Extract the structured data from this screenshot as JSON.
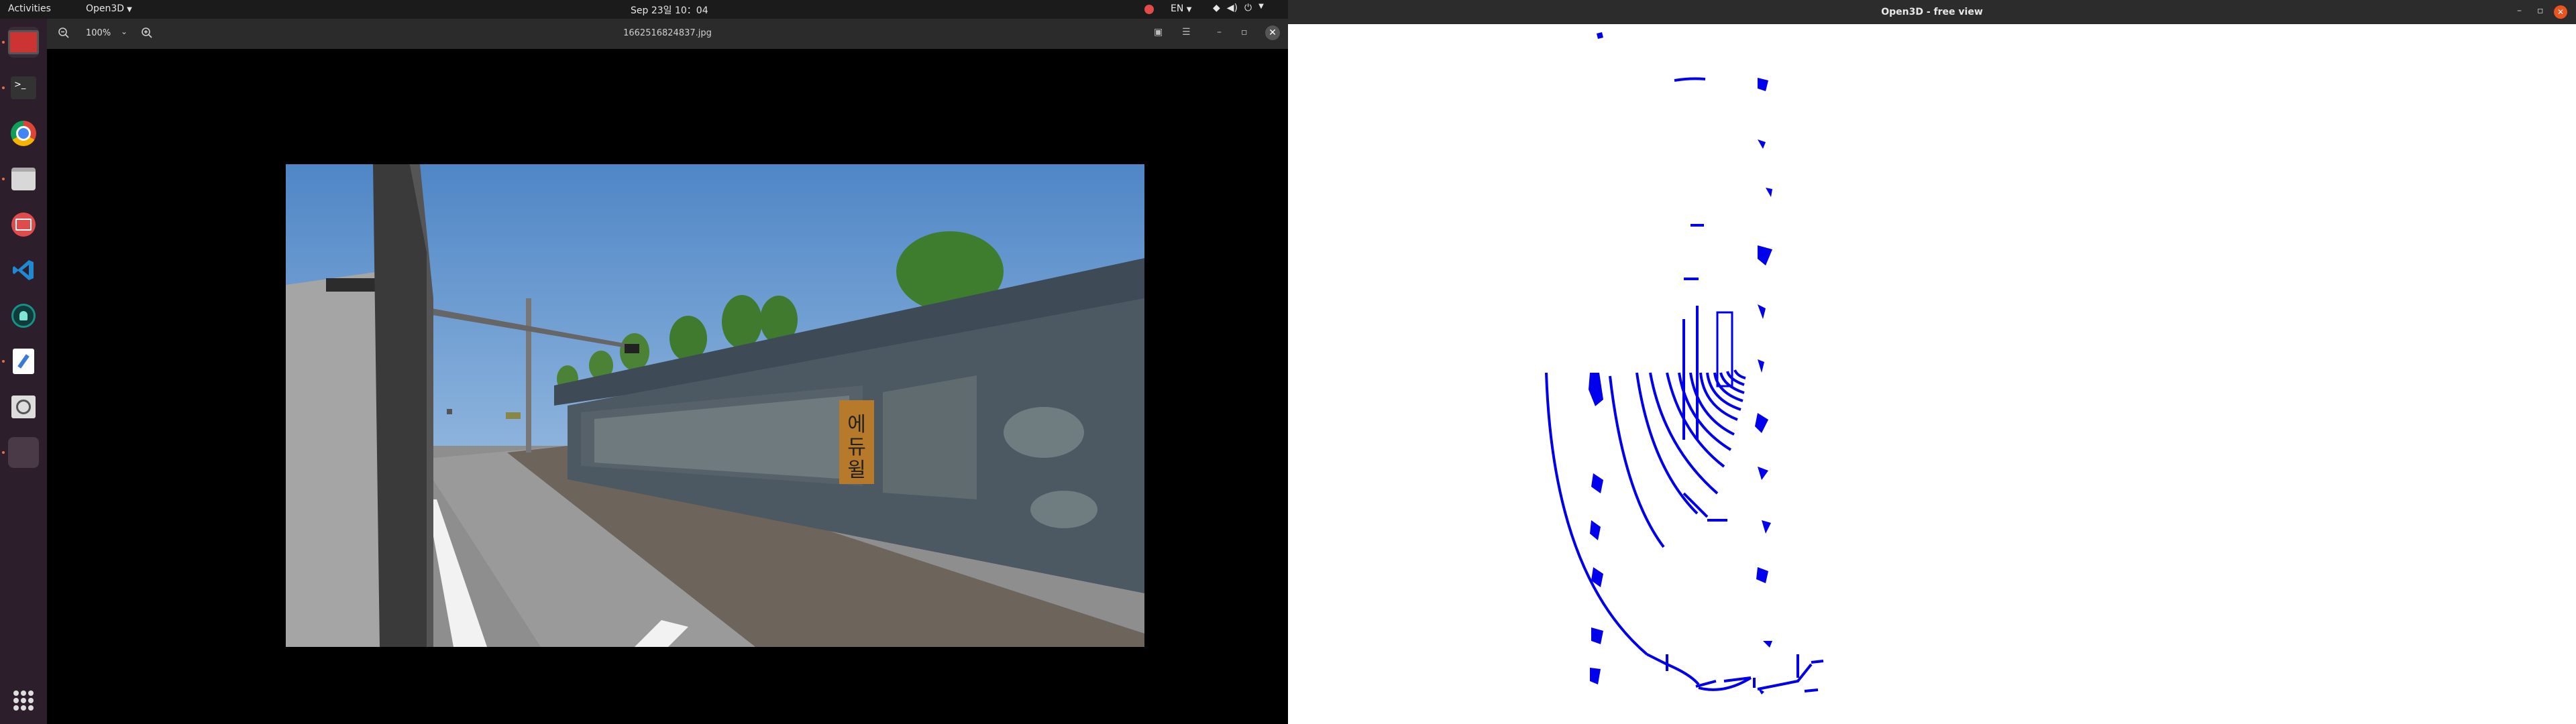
{
  "topbar": {
    "activities": "Activities",
    "app_name": "Open3D",
    "clock": "Sep 23일  10：04",
    "lang": "EN"
  },
  "viewer": {
    "zoom": "100%",
    "filename": "1662516824837.jpg",
    "sign_text": "에듀윌"
  },
  "open3d": {
    "title": "Open3D - free view"
  },
  "dock_apps": [
    "terminal-viewer",
    "terminal",
    "chrome",
    "files",
    "screenshot",
    "vscode",
    "gitkraken",
    "text-editor",
    "image-viewer",
    "recent"
  ],
  "colors": {
    "dock_bg": "#2d1e2c",
    "topbar_bg": "#1b1b1b",
    "point_cloud": "#0000ee",
    "close_orange": "#e95420"
  }
}
